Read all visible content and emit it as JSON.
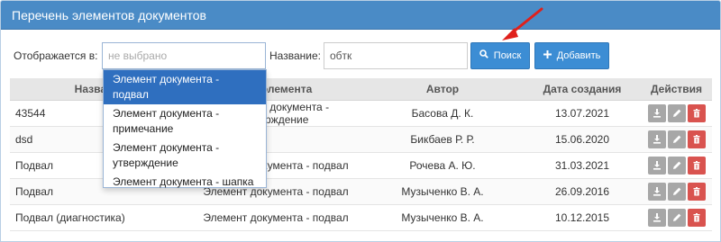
{
  "panel": {
    "title": "Перечень элементов документов"
  },
  "filter": {
    "display_label": "Отображается в:",
    "display_placeholder": "не выбрано",
    "name_label": "Название:",
    "name_value": "обтк",
    "search_label": "Поиск",
    "add_label": "Добавить"
  },
  "dropdown": {
    "options": [
      "Элемент документа - подвал",
      "Элемент документа - примечание",
      "Элемент документа - утверждение",
      "Элемент документа - шапка"
    ],
    "selected_index": 0
  },
  "table": {
    "headers": [
      "Название",
      "Тип элемента",
      "Автор",
      "Дата создания",
      "Действия"
    ],
    "rows": [
      [
        "43544",
        "Элемент документа - утверждение",
        "Басова Д. К.",
        "13.07.2021"
      ],
      [
        "dsd",
        "",
        "Бикбаев Р. Р.",
        "15.06.2020"
      ],
      [
        "Подвал",
        "Элемент документа - подвал",
        "Рочева А. Ю.",
        "31.03.2021"
      ],
      [
        "Подвал",
        "Элемент документа - подвал",
        "Музыченко В. А.",
        "26.09.2016"
      ],
      [
        "Подвал (диагностика)",
        "Элемент документа - подвал",
        "Музыченко В. А.",
        "10.12.2015"
      ]
    ]
  },
  "colors": {
    "header": "#4a8bc6",
    "button": "#3c8dd4",
    "delete": "#d9534f",
    "action_gray": "#a7a7a7",
    "annotation_arrow": "#e0201b"
  },
  "icons": {
    "search": "search-icon",
    "add": "plus-icon",
    "download": "download-icon",
    "edit": "pencil-icon",
    "delete": "trash-icon"
  }
}
